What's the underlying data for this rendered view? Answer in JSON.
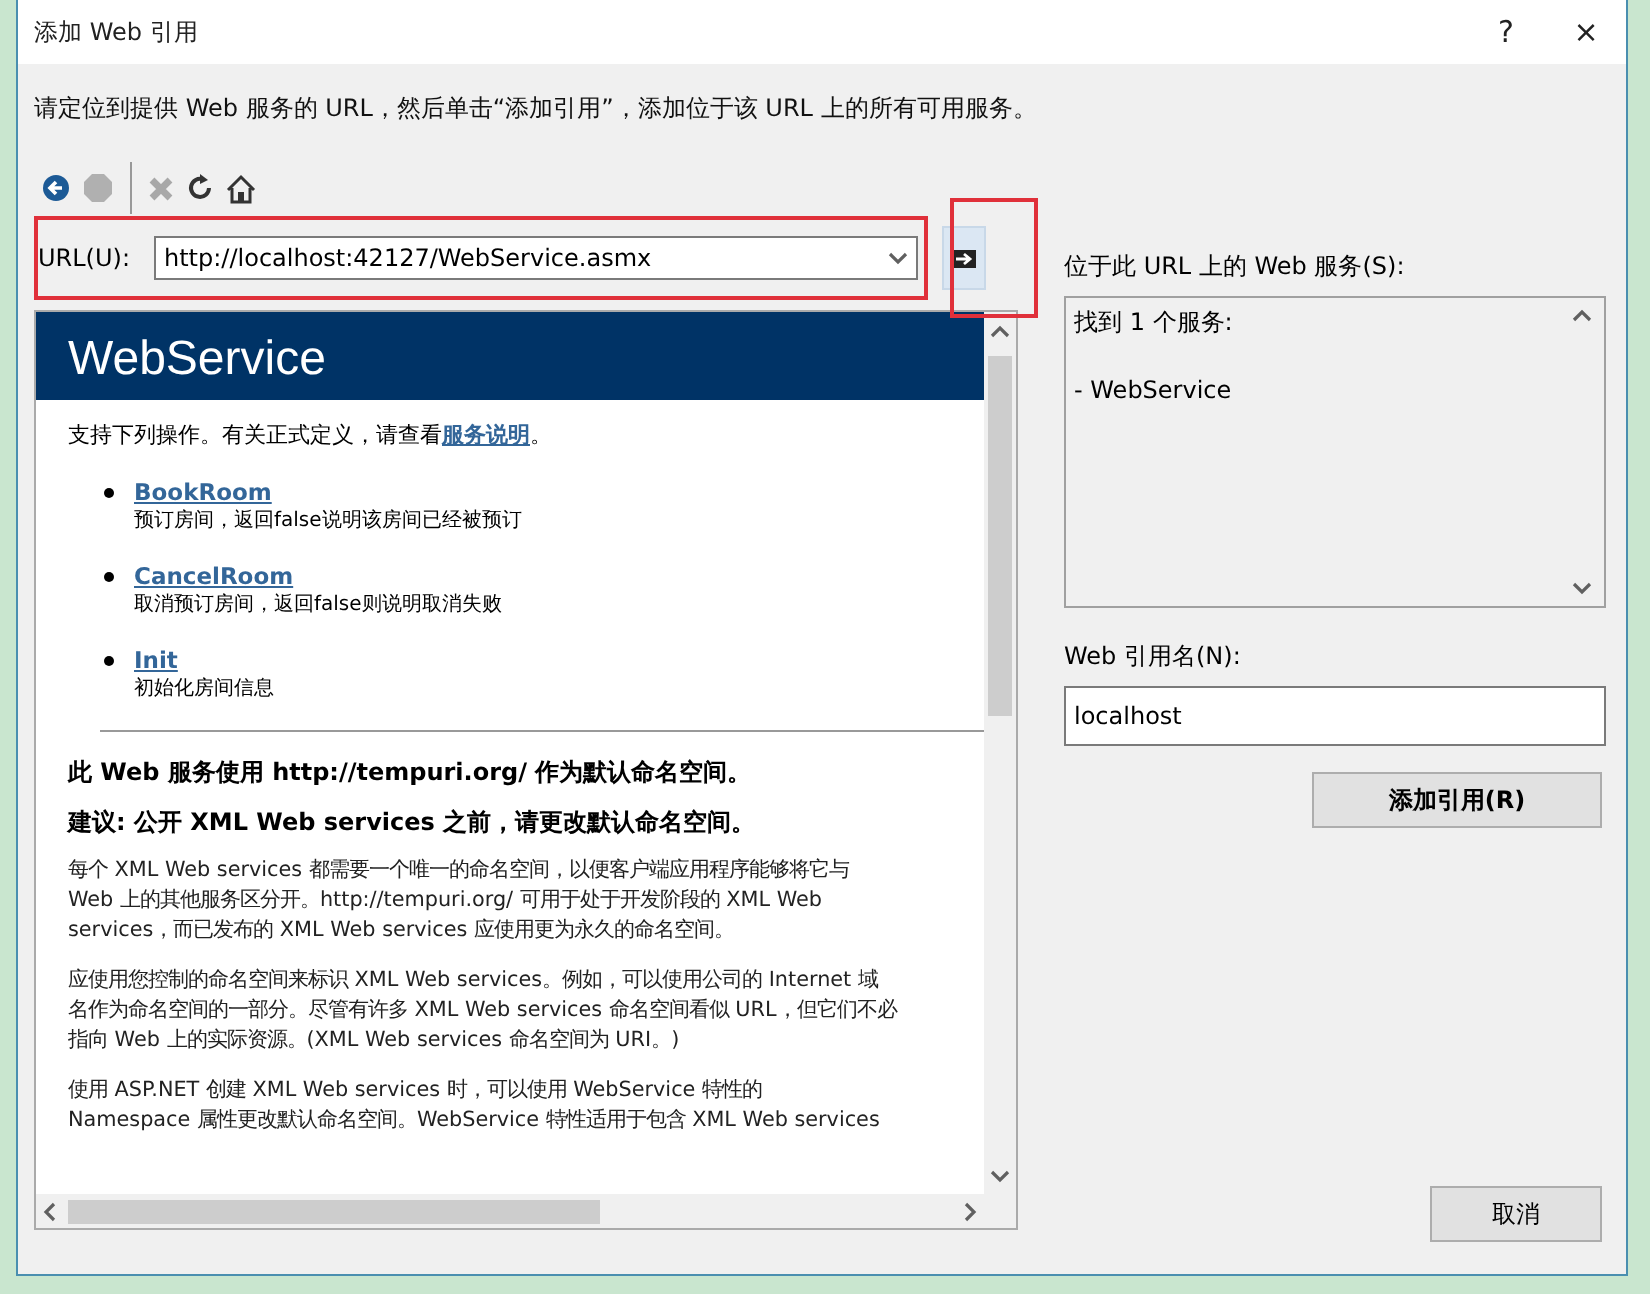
{
  "window": {
    "title": "添加 Web 引用",
    "help": "?",
    "close": "×"
  },
  "instruction": "请定位到提供 Web 服务的 URL，然后单击“添加引用”，添加位于该 URL 上的所有可用服务。",
  "url": {
    "label": "URL(U):",
    "value": "http://localhost:42127/WebService.asmx"
  },
  "browser": {
    "header": "WebService",
    "intro": "支持下列操作。有关正式定义，请查看",
    "intro_link": "服务说明",
    "intro_end": "。",
    "operations": [
      {
        "name": "BookRoom",
        "description": "预订房间，返回false说明该房间已经被预订"
      },
      {
        "name": "CancelRoom",
        "description": "取消预订房间，返回false则说明取消失败"
      },
      {
        "name": "Init",
        "description": "初始化房间信息"
      }
    ],
    "namespace_notice": "此 Web 服务使用 http://tempuri.org/ 作为默认命名空间。",
    "recommendation": "建议: 公开 XML Web services 之前，请更改默认命名空间。",
    "paragraphs": [
      {
        "lines": [
          "每个 XML Web services 都需要一个唯一的命名空间，以便客户端应用程序能够将它与",
          "Web 上的其他服务区分开。http://tempuri.org/ 可用于处于开发阶段的 XML Web",
          "services，而已发布的 XML Web services 应使用更为永久的命名空间。"
        ]
      },
      {
        "lines": [
          "应使用您控制的命名空间来标识 XML Web services。例如，可以使用公司的 Internet 域",
          "名作为命名空间的一部分。尽管有许多 XML Web services 命名空间看似 URL，但它们不必",
          "指向 Web 上的实际资源。(XML Web services 命名空间为 URI。)"
        ]
      },
      {
        "lines": [
          "使用 ASP.NET 创建 XML Web services 时，可以使用 WebService 特性的",
          "Namespace 属性更改默认命名空间。WebService 特性适用于包含 XML Web services"
        ]
      }
    ]
  },
  "services": {
    "label": "位于此 URL 上的 Web 服务(S):",
    "lines": [
      "找到 1 个服务:",
      "- WebService"
    ]
  },
  "reference_name": {
    "label": "Web 引用名(N):",
    "value": "localhost"
  },
  "buttons": {
    "add": "添加引用(R)",
    "cancel": "取消"
  }
}
